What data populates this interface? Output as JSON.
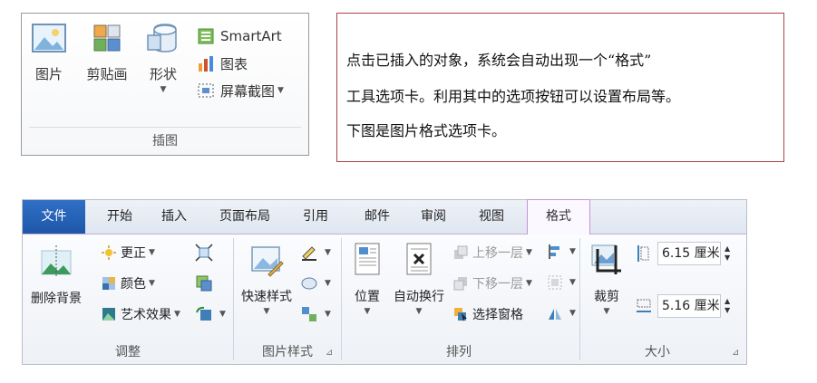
{
  "illustrations": {
    "picture_label": "图片",
    "clipart_label": "剪贴画",
    "shapes_label": "形状",
    "smartart_label": "SmartArt",
    "chart_label": "图表",
    "screenshot_label": "屏幕截图",
    "group_label": "插图"
  },
  "note": {
    "line1": "点击已插入的对象，系统会自动出现一个“格式”",
    "line2": "工具选项卡。利用其中的选项按钮可以设置布局等。",
    "line3": "下图是图片格式选项卡。"
  },
  "ribbon": {
    "tabs": [
      "文件",
      "开始",
      "插入",
      "页面布局",
      "引用",
      "邮件",
      "审阅",
      "视图",
      "格式"
    ],
    "active_tab": "格式",
    "adjust": {
      "remove_bg": "删除背景",
      "corrections": "更正",
      "color": "颜色",
      "artistic": "艺术效果",
      "group_label": "调整"
    },
    "styles": {
      "quick_styles": "快速样式",
      "group_label": "图片样式"
    },
    "arrange": {
      "position": "位置",
      "wrap_text": "自动换行",
      "bring_forward": "上移一层",
      "send_backward": "下移一层",
      "selection_pane": "选择窗格",
      "group_label": "排列"
    },
    "size": {
      "crop": "裁剪",
      "height": "6.15 厘米",
      "width": "5.16 厘米",
      "group_label": "大小"
    }
  },
  "colors": {
    "file_tab": "#1e57a8",
    "format_tab_border": "#c794d8",
    "note_border": "#b0404a"
  }
}
